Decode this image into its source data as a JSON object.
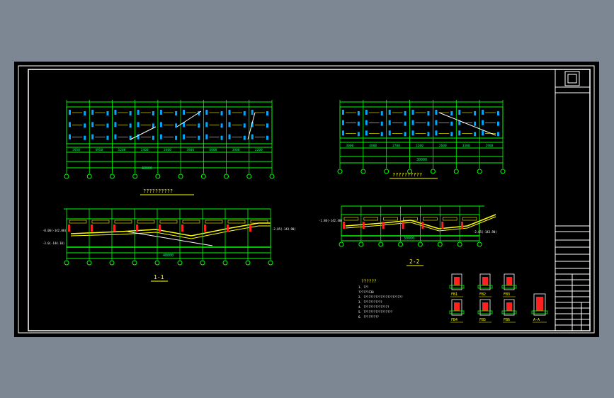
{
  "colors": {
    "background": "#7c8793",
    "canvas": "#000000",
    "frame": "#ffffff",
    "structure": "#00ff00",
    "text": "#ffff00",
    "fill": "#00a8ff",
    "section": "#ff2020",
    "dims": "#00ff66"
  },
  "plan_left": {
    "title": "??????????",
    "dims_lower": [
      "3950",
      "4950",
      "5200",
      "2400",
      "3400",
      "3900",
      "6800",
      "3900",
      "2200"
    ],
    "total": "48000"
  },
  "plan_right": {
    "title": "??????????",
    "dims_lower": [
      "3000",
      "4000",
      "2700",
      "2200",
      "2600",
      "3300",
      "2900"
    ],
    "total": "30000"
  },
  "section_1": {
    "label": "1-1",
    "elevations": [
      "-0.06(-142.00)",
      "-3.0(-144.10)",
      "-2.85(-143.90)"
    ],
    "total": "48000"
  },
  "section_2": {
    "label": "2-2",
    "elevations": [
      "-1.86(-142.40)",
      "-2.85(-143.90)"
    ],
    "total": "30000"
  },
  "notes": {
    "heading": "??????",
    "lines": [
      "1. ???",
      "   ??????C30",
      "2. ???????????????????????",
      "3. ???????????",
      "4. ???????????????",
      "5. ?????????????????",
      "6. ?????????"
    ]
  },
  "details": [
    {
      "label": "FB1"
    },
    {
      "label": "FB2"
    },
    {
      "label": "FB3"
    },
    {
      "label": "FB4"
    },
    {
      "label": "FB5"
    },
    {
      "label": "FB6"
    },
    {
      "label": "A-A"
    }
  ],
  "title_block": {
    "rows": [
      "",
      "",
      "",
      "",
      "",
      "",
      "",
      "",
      "",
      "",
      "",
      ""
    ]
  }
}
